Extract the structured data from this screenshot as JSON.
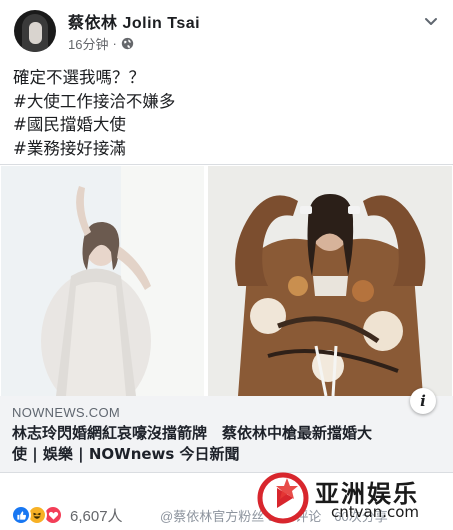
{
  "post": {
    "author": "蔡依林 Jolin Tsai",
    "time": "16分钟",
    "privacy_separator": "·",
    "privacy_icon": "globe-icon",
    "more_icon": "chevron-down-icon",
    "lines": [
      "確定不選我嗎？？",
      "#大使工作接洽不嫌多",
      "#國民擋婚大使",
      "#業務接好接滿"
    ]
  },
  "link_card": {
    "domain": "NOWNEWS.COM",
    "title_lines": [
      "林志玲閃婚網紅哀嚎沒擋箭牌　蔡依林中槍最新擋婚大",
      "使 | 娛樂 | NOWnews 今日新聞"
    ],
    "info_label": "i"
  },
  "reactions": {
    "count": "6,607人",
    "icons": [
      "like-icon",
      "haha-icon",
      "love-icon"
    ],
    "colors": {
      "like": "#1877f2",
      "haha": "#f7b125",
      "love": "#f33e58"
    }
  },
  "footer": {
    "stats_text": "@蔡依林官方粉丝 59条评论　60次分享"
  },
  "watermark": {
    "cn": "亚洲娱乐",
    "en": "cntvan.com"
  }
}
